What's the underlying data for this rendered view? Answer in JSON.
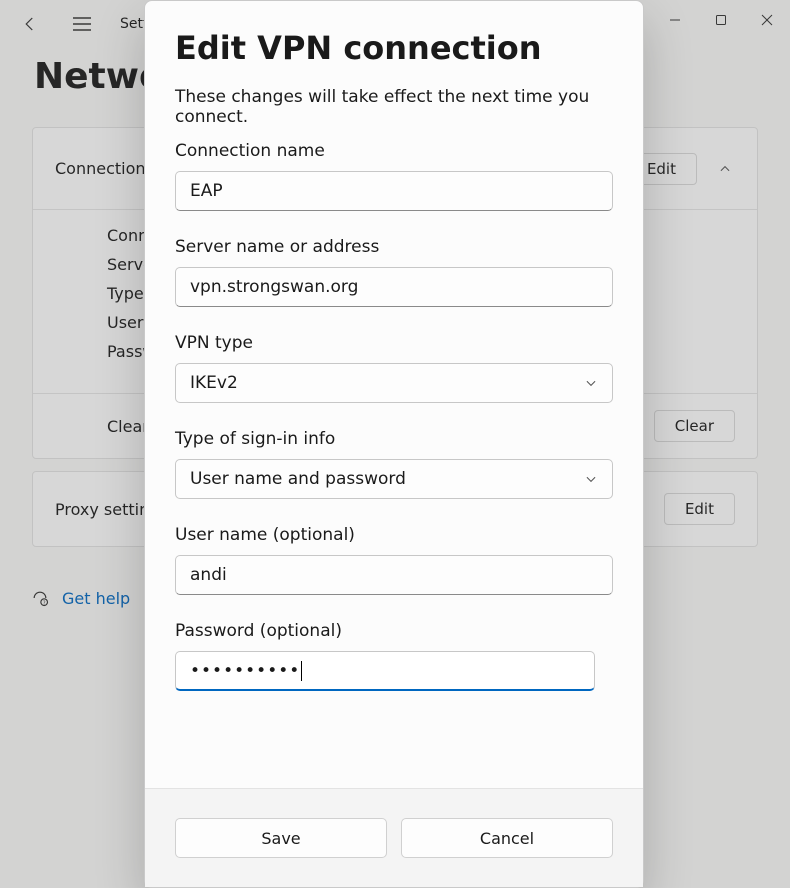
{
  "window": {
    "settings_label": "Settings"
  },
  "background": {
    "heading": "Network",
    "connection_panel": {
      "header": "Connection",
      "edit_label": "Edit",
      "rows": {
        "connection": "Connection",
        "server": "Server",
        "type": "Type",
        "user": "User",
        "password": "Password"
      },
      "clear_label": "Clear",
      "clear_button": "Clear"
    },
    "proxy_panel": {
      "label": "Proxy settings",
      "edit_label": "Edit"
    },
    "help_link": "Get help"
  },
  "dialog": {
    "title": "Edit VPN connection",
    "subtitle": "These changes will take effect the next time you connect.",
    "fields": {
      "connection_name": {
        "label": "Connection name",
        "value": "EAP"
      },
      "server": {
        "label": "Server name or address",
        "value": "vpn.strongswan.org"
      },
      "vpn_type": {
        "label": "VPN type",
        "value": "IKEv2"
      },
      "signin_type": {
        "label": "Type of sign-in info",
        "value": "User name and password"
      },
      "username": {
        "label": "User name (optional)",
        "value": "andi"
      },
      "password": {
        "label": "Password (optional)",
        "value": "••••••••••"
      }
    },
    "save_label": "Save",
    "cancel_label": "Cancel"
  }
}
